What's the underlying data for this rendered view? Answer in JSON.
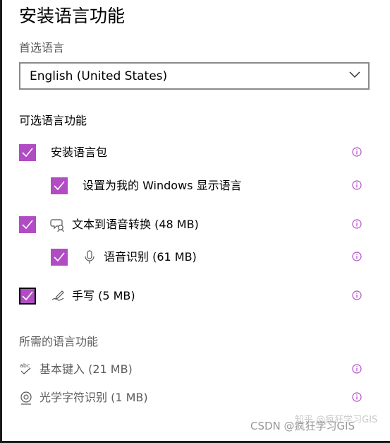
{
  "title": "安装语言功能",
  "preferred_language": {
    "heading": "首选语言",
    "selected": "English (United States)"
  },
  "optional_features": {
    "heading": "可选语言功能",
    "items": [
      {
        "label": "安装语言包",
        "checked": true
      },
      {
        "label": "设置为我的 Windows 显示语言",
        "checked": true
      },
      {
        "label": "文本到语音转换 (48 MB)",
        "checked": true,
        "icon": "text-to-speech-icon"
      },
      {
        "label": "语音识别 (61 MB)",
        "checked": true,
        "icon": "microphone-icon"
      },
      {
        "label": "手写 (5 MB)",
        "checked": true,
        "icon": "handwriting-icon"
      }
    ]
  },
  "required_features": {
    "heading": "所需的语言功能",
    "items": [
      {
        "label": "基本键入 (21 MB)",
        "icon": "abc-typing-icon"
      },
      {
        "label": "光学字符识别 (1 MB)",
        "icon": "ocr-icon"
      }
    ]
  },
  "watermark": {
    "text": "CSDN @疯狂学习GIS",
    "bg_text": "知乎 @疯狂学习GIS"
  },
  "colors": {
    "accent": "#b14cc4",
    "info_icon": "#b14cc4",
    "muted_text": "#5c5c5c"
  }
}
